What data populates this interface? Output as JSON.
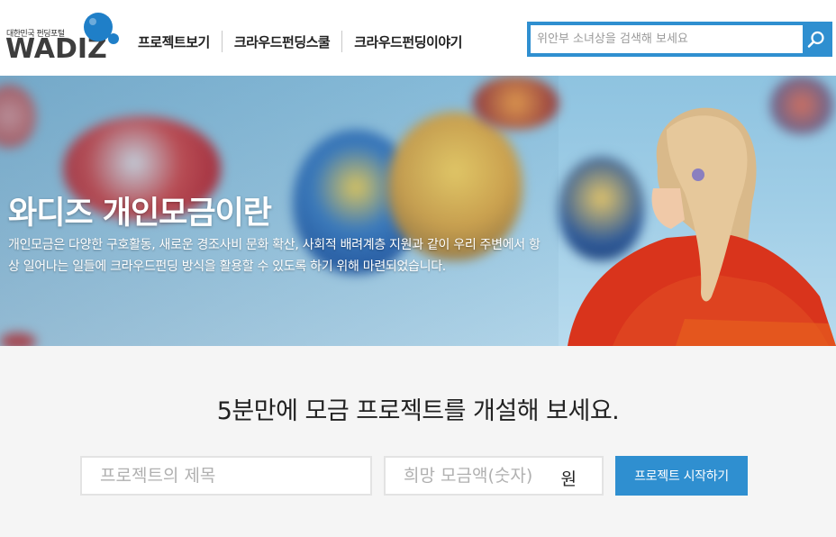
{
  "header": {
    "logo_tagline": "대한민국 펀딩포털",
    "logo_text": "WADIZ",
    "nav": [
      "프로젝트보기",
      "크라우드펀딩스쿨",
      "크라우드펀딩이야기"
    ],
    "search_placeholder": "위안부 소녀상을 검색해 보세요"
  },
  "hero": {
    "title": "와디즈 개인모금이란",
    "description": "개인모금은 다양한 구호활동, 새로운 경조사비 문화 확산, 사회적 배려계층 지원과 같이 우리 주변에서 항상 일어나는 일들에 크라우드펀딩 방식을 활용할 수 있도록 하기 위해 마련되었습니다."
  },
  "cta": {
    "title": "5분만에 모금 프로젝트를 개설해 보세요.",
    "project_title_placeholder": "프로젝트의 제목",
    "amount_placeholder": "희망 모금액(숫자)",
    "currency_unit": "원",
    "start_button": "프로젝트 시작하기"
  },
  "colors": {
    "accent": "#2f8fd0",
    "logo_blue": "#1f7fc8",
    "sweater": "#d9341c"
  }
}
